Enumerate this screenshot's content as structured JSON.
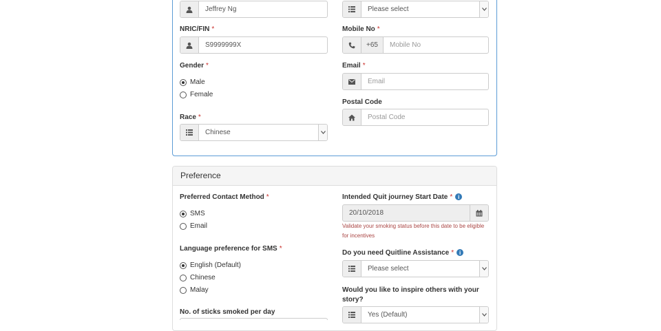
{
  "personal": {
    "name_value": "Jeffrey Ng",
    "top_select_value": "Please select",
    "nric_label": "NRIC/FIN",
    "nric_value": "S9999999X",
    "mobile_label": "Mobile No",
    "mobile_prefix": "+65",
    "mobile_placeholder": "Mobile No",
    "gender_label": "Gender",
    "gender_options": [
      "Male",
      "Female"
    ],
    "gender_selected": "Male",
    "email_label": "Email",
    "email_placeholder": "Email",
    "postal_label": "Postal Code",
    "postal_placeholder": "Postal Code",
    "race_label": "Race",
    "race_value": "Chinese",
    "required_mark": "*"
  },
  "preference": {
    "title": "Preference",
    "contact_label": "Preferred Contact Method",
    "contact_options": [
      "SMS",
      "Email"
    ],
    "contact_selected": "SMS",
    "language_label": "Language preference for SMS",
    "language_options": [
      "English (Default)",
      "Chinese",
      "Malay"
    ],
    "language_selected": "English (Default)",
    "sticks_label": "No. of sticks smoked per day",
    "quit_date_label": "Intended Quit journey Start Date",
    "quit_date_value": "20/10/2018",
    "quit_date_hint": "Validate your smoking status before this date to be eligible for incentives",
    "quitline_label": "Do you need Quitline Assistance",
    "quitline_value": "Please select",
    "inspire_label": "Would you like to inspire others with your story?",
    "inspire_value": "Yes (Default)"
  },
  "icons": {
    "user": "user-icon",
    "list": "list-icon",
    "phone": "phone-icon",
    "envelope": "envelope-icon",
    "home": "home-icon",
    "calendar": "calendar-icon",
    "info": "info-icon",
    "caret": "chevron-down-icon"
  },
  "colors": {
    "panel_border_active": "#5b9bd5",
    "required": "#c9302c",
    "hint": "#a94442",
    "info": "#337ab7"
  }
}
